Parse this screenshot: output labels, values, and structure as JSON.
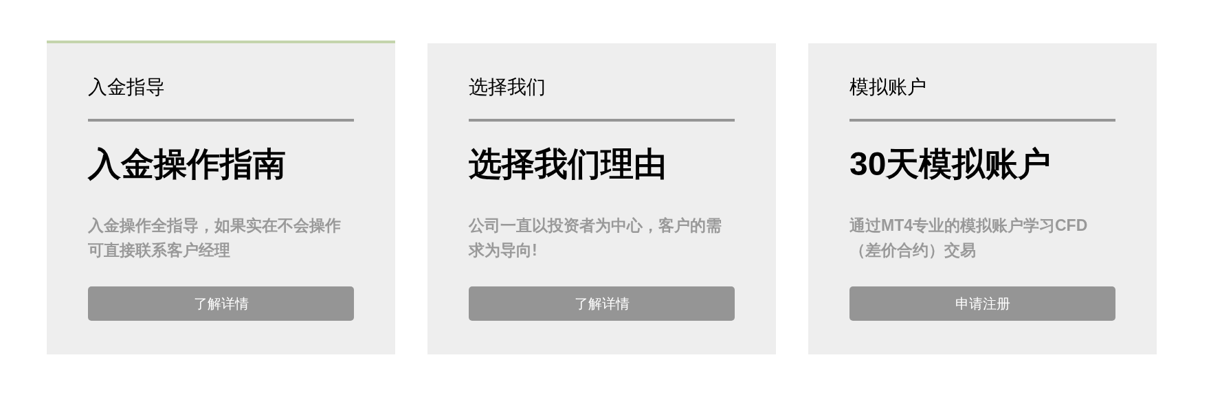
{
  "cards": [
    {
      "category": "入金指导",
      "heading": "入金操作指南",
      "description": "入金操作全指导，如果实在不会操作可直接联系客户经理",
      "button": "了解详情",
      "selected": true
    },
    {
      "category": "选择我们",
      "heading": "选择我们理由",
      "description": "公司一直以投资者为中心，客户的需求为导向!",
      "button": "了解详情",
      "selected": false
    },
    {
      "category": "模拟账户",
      "heading": "30天模拟账户",
      "description": "通过MT4专业的模拟账户学习CFD（差价合约）交易",
      "button": "申请注册",
      "selected": false
    }
  ]
}
